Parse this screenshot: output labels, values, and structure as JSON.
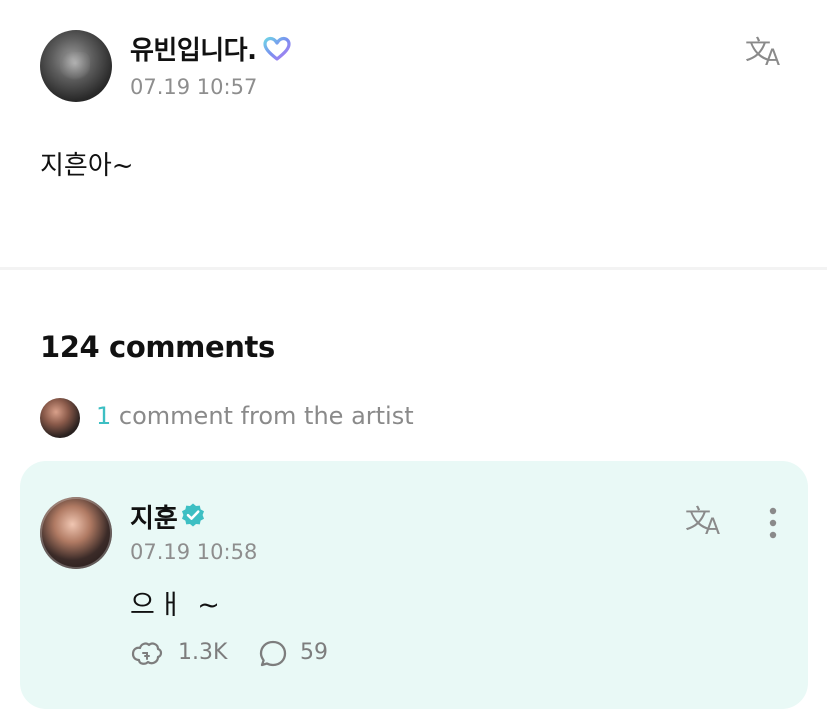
{
  "post": {
    "author": "유빈입니다.",
    "timestamp": "07.19 10:57",
    "body": "지흔아~",
    "badge_icon": "heart-badge-icon",
    "translate_icon": "translate-icon"
  },
  "comments": {
    "count_label": "124 comments",
    "artist_summary": {
      "count": "1",
      "label": "comment from the artist"
    }
  },
  "artist_comment": {
    "author": "지훈",
    "timestamp": "07.19 10:58",
    "body": "으ㅐ ~",
    "likes": "1.3K",
    "replies": "59",
    "badge_icon": "verified-icon",
    "card_color": "#e9f9f6",
    "accent_color": "#3dbfc3"
  }
}
